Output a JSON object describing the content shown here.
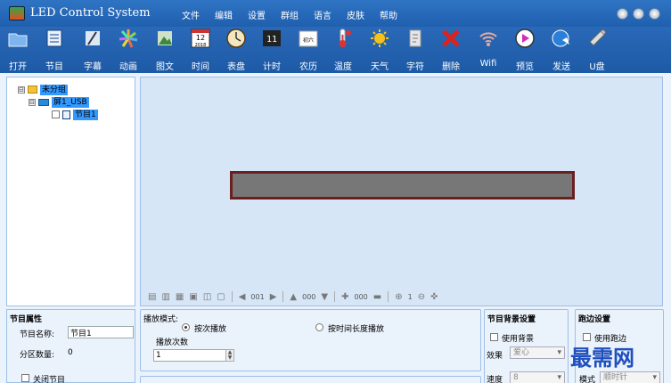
{
  "window": {
    "title": "LED Control System"
  },
  "menu": [
    "文件",
    "编辑",
    "设置",
    "群组",
    "语言",
    "皮肤",
    "帮助"
  ],
  "toolbar": [
    {
      "label": "打开",
      "icon": "folder-icon"
    },
    {
      "label": "节目",
      "icon": "program-icon"
    },
    {
      "label": "字幕",
      "icon": "subtitle-icon"
    },
    {
      "label": "动画",
      "icon": "animation-icon"
    },
    {
      "label": "图文",
      "icon": "image-text-icon"
    },
    {
      "label": "时间",
      "icon": "calendar-icon"
    },
    {
      "label": "表盘",
      "icon": "clock-icon"
    },
    {
      "label": "计时",
      "icon": "timer-icon"
    },
    {
      "label": "农历",
      "icon": "lunar-calendar-icon"
    },
    {
      "label": "温度",
      "icon": "thermometer-icon"
    },
    {
      "label": "天气",
      "icon": "sun-icon"
    },
    {
      "label": "字符",
      "icon": "character-icon"
    },
    {
      "label": "删除",
      "icon": "delete-icon"
    },
    {
      "label": "Wifi",
      "icon": "wifi-icon"
    },
    {
      "label": "预览",
      "icon": "play-icon"
    },
    {
      "label": "发送",
      "icon": "send-icon"
    },
    {
      "label": "U盘",
      "icon": "usb-icon"
    }
  ],
  "icon_texts": {
    "calendar_day": "12",
    "calendar_year": "2018",
    "timer_digits": "11",
    "lunar_text": "初六"
  },
  "tree": {
    "group": "未分组",
    "screen": "屏1_USB",
    "program": "节目1",
    "toggle_minus": "⊟"
  },
  "canvas_controls": {
    "frame_index": "001",
    "order_value": "000",
    "size_value": "000",
    "zoom": "1"
  },
  "program_props": {
    "title": "节目属性",
    "name_label": "节目名称:",
    "name_value": "节目1",
    "partition_label": "分区数量:",
    "partition_value": "0",
    "close_label": "关闭节目"
  },
  "play_mode": {
    "title": "播放模式:",
    "option1": "按次播放",
    "option2": "按时间长度播放",
    "count_label": "播放次数",
    "count_value": "1"
  },
  "bg_settings": {
    "title": "节目背景设置",
    "use_bg": "使用背景",
    "effect_label": "效果",
    "effect_value": "爱心",
    "speed_label": "速度",
    "speed_value": "8"
  },
  "border_settings": {
    "title": "跑边设置",
    "use_border": "使用跑边",
    "mode_label": "模式",
    "mode_value": "顺时针"
  },
  "watermark": "最需网",
  "colors": {
    "titlebar": "#1f5fae",
    "toolbar": "#2a69b8",
    "panel_border": "#9fc0e6",
    "screen_frame": "#6b1f1f",
    "screen_fill": "#777777"
  }
}
